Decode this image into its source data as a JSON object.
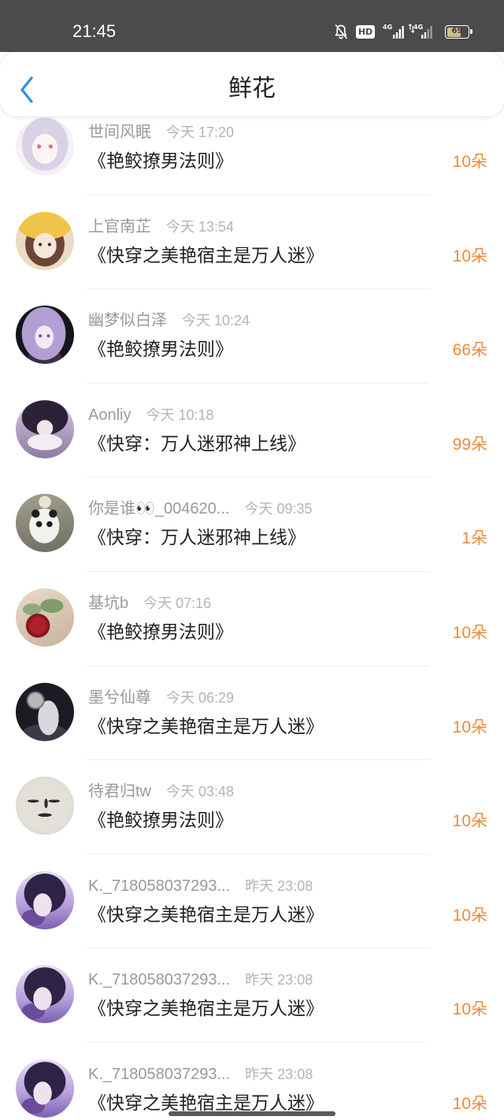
{
  "theme": {
    "status_bar_bg": "#4b4b4b",
    "accent": "#2e8fe2",
    "flower_count": "#ef8a3c",
    "title_text": "#1f1f1f"
  },
  "status_bar": {
    "time": "21:45",
    "hd_label": "HD",
    "network_1": "4G",
    "network_2": "4G",
    "battery_percent": "69",
    "icons": [
      "bell-off-icon",
      "hd-icon",
      "signal-4g-icon",
      "signal-4g-data-icon",
      "battery-icon"
    ]
  },
  "header": {
    "back_icon": "chevron-left-icon",
    "title": "鲜花"
  },
  "list": {
    "items": [
      {
        "name": "世间风眠",
        "time": "今天 17:20",
        "book": "《艳鲛撩男法则》",
        "count": "10朵"
      },
      {
        "name": "上官南芷",
        "time": "今天 13:54",
        "book": "《快穿之美艳宿主是万人迷》",
        "count": "10朵"
      },
      {
        "name": "幽梦似白泽",
        "time": "今天 10:24",
        "book": "《艳鲛撩男法则》",
        "count": "66朵"
      },
      {
        "name": "Aonliy",
        "time": "今天 10:18",
        "book": "《快穿：万人迷邪神上线》",
        "count": "99朵"
      },
      {
        "name": "你是谁👀_004620...",
        "time": "今天 09:35",
        "book": "《快穿：万人迷邪神上线》",
        "count": "1朵"
      },
      {
        "name": "基坑b",
        "time": "今天 07:16",
        "book": "《艳鲛撩男法则》",
        "count": "10朵"
      },
      {
        "name": "墨兮仙尊",
        "time": "今天 06:29",
        "book": "《快穿之美艳宿主是万人迷》",
        "count": "10朵"
      },
      {
        "name": "待君归tw",
        "time": "今天 03:48",
        "book": "《艳鲛撩男法则》",
        "count": "10朵"
      },
      {
        "name": "K._718058037293...",
        "time": "昨天 23:08",
        "book": "《快穿之美艳宿主是万人迷》",
        "count": "10朵"
      },
      {
        "name": "K._718058037293...",
        "time": "昨天 23:08",
        "book": "《快穿之美艳宿主是万人迷》",
        "count": "10朵"
      },
      {
        "name": "K._718058037293...",
        "time": "昨天 23:08",
        "book": "《快穿之美艳宿主是万人迷》",
        "count": "10朵"
      }
    ]
  }
}
